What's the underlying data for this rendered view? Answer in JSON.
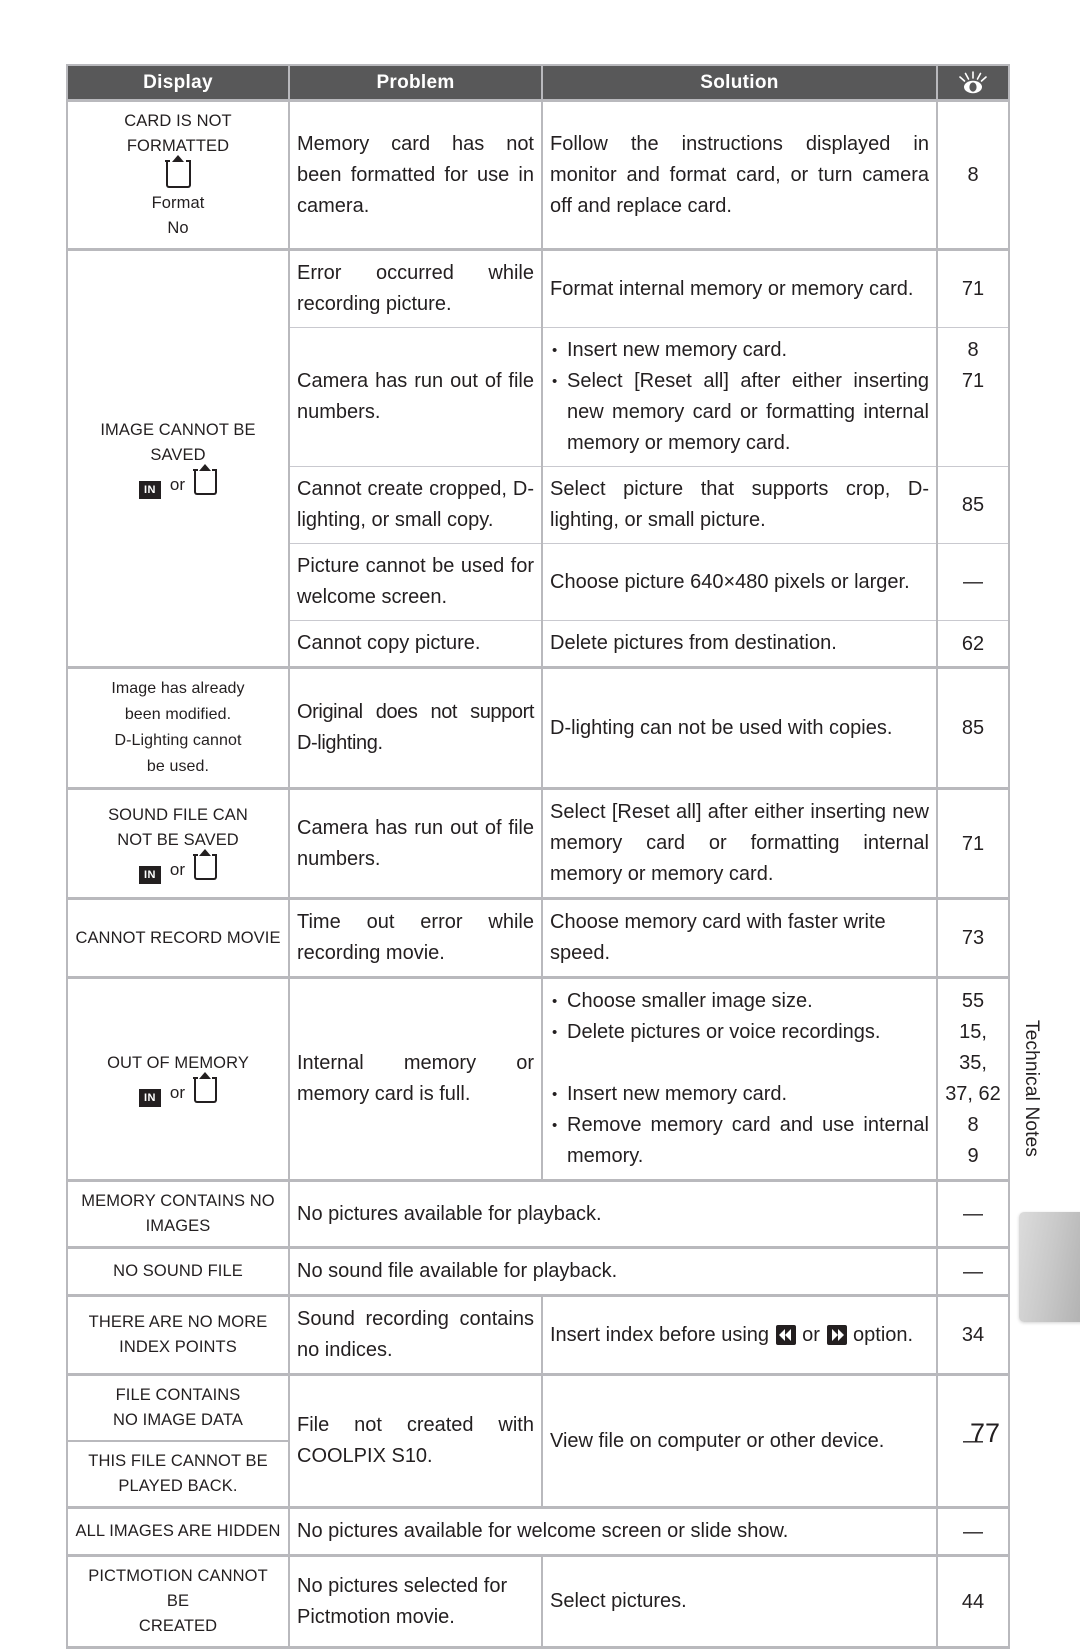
{
  "page": {
    "number": "77",
    "side_tab_label": "Technical Notes"
  },
  "table": {
    "headers": {
      "display": "Display",
      "problem": "Problem",
      "solution": "Solution",
      "page_ref_icon": "eye-with-rays-icon"
    },
    "rows": [
      {
        "display_lines": [
          "CARD IS NOT",
          "FORMATTED"
        ],
        "display_icons": [
          "memory-card-icon"
        ],
        "display_after": [
          "Format",
          "No"
        ],
        "problem": "Memory card has not been formatted for use in camera.",
        "solution": "Follow the instructions displayed in monitor and format card, or turn camera off and replace card.",
        "page": "8"
      },
      {
        "display_lines": [
          "IMAGE CANNOT BE SAVED"
        ],
        "display_icons": [
          "internal-memory-icon",
          "memory-card-icon"
        ],
        "or_label": "or",
        "subrows": [
          {
            "problem": "Error occurred while recording picture.",
            "solution": "Format internal memory or memory card.",
            "page": "71"
          },
          {
            "problem": "Camera has run out of file numbers.",
            "solution_bullets": [
              "Insert new memory card.",
              "Select [Reset all] after either inserting new memory card or formatting internal memory or memory card."
            ],
            "pages": [
              "8",
              "71"
            ]
          },
          {
            "problem": "Cannot create cropped, D-lighting, or small copy.",
            "solution": "Select picture that supports crop, D-lighting, or small picture.",
            "page": "85"
          },
          {
            "problem": "Picture cannot be used for welcome screen.",
            "solution": "Choose picture 640×480 pixels or larger.",
            "page": "—"
          },
          {
            "problem": "Cannot copy picture.",
            "solution": "Delete pictures from destination.",
            "page": "62"
          }
        ]
      },
      {
        "display_lines": [
          "Image has already",
          "been modified.",
          "D-Lighting cannot",
          "be used."
        ],
        "problem": "Original does not support D-lighting.",
        "solution": "D-lighting can not be used with copies.",
        "page": "85"
      },
      {
        "display_lines": [
          "SOUND FILE CAN",
          "NOT BE SAVED"
        ],
        "display_icons": [
          "internal-memory-icon",
          "memory-card-icon"
        ],
        "or_label": "or",
        "problem": "Camera has run out of file numbers.",
        "solution": "Select [Reset all] after either inserting new memory card or formatting internal memory or memory card.",
        "page": "71"
      },
      {
        "display_lines": [
          "CANNOT RECORD MOVIE"
        ],
        "problem": "Time out error while recording movie.",
        "solution": "Choose memory card with faster write speed.",
        "page": "73"
      },
      {
        "display_lines": [
          "OUT OF MEMORY"
        ],
        "display_icons": [
          "internal-memory-icon",
          "memory-card-icon"
        ],
        "or_label": "or",
        "problem": "Internal memory or memory card is full.",
        "solution_bullets": [
          "Choose smaller image size.",
          "Delete pictures or voice recordings.",
          "Insert new memory card.",
          "Remove memory card and use internal memory."
        ],
        "pages": [
          "55",
          "15, 35,",
          "37, 62",
          "8",
          "9"
        ]
      },
      {
        "display_lines": [
          "MEMORY CONTAINS NO",
          "IMAGES"
        ],
        "problem": "No pictures available for playback.",
        "solution": "",
        "page": "—"
      },
      {
        "display_lines": [
          "NO SOUND FILE"
        ],
        "problem": "No sound file available for playback.",
        "solution": "",
        "page": "—"
      },
      {
        "display_lines": [
          "THERE ARE NO MORE",
          "INDEX POINTS"
        ],
        "problem": "Sound recording contains no indices.",
        "solution_pre": "Insert index before using ",
        "solution_icons": [
          "skip-back-icon",
          "skip-forward-icon"
        ],
        "solution_or": " or ",
        "solution_post": " option.",
        "page": "34"
      },
      {
        "display_lines_a": [
          "FILE CONTAINS",
          "NO IMAGE DATA"
        ],
        "display_lines_b": [
          "THIS FILE CANNOT BE",
          "PLAYED BACK."
        ],
        "problem": "File not created with COOLPIX S10.",
        "solution": "View file on computer or other device.",
        "page": "—"
      },
      {
        "display_lines": [
          "ALL IMAGES ARE HIDDEN"
        ],
        "problem": "No pictures available for welcome screen or slide show.",
        "solution": "",
        "page": "—"
      },
      {
        "display_lines": [
          "PICTMOTION CANNOT BE",
          "CREATED"
        ],
        "problem": "No pictures selected for Pictmotion movie.",
        "solution": "Select pictures.",
        "page": "44"
      }
    ]
  },
  "colors": {
    "header_bg": "#585859",
    "border": "#b9b9bd",
    "inner_border": "#c9c9cf",
    "text": "#231f20"
  }
}
